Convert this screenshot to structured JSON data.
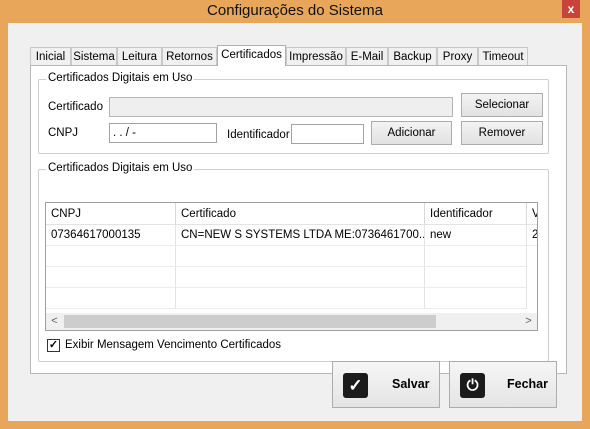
{
  "window": {
    "title": "Configurações do Sistema",
    "close_glyph": "x"
  },
  "tabs": [
    "Inicial",
    "Sistema",
    "Leitura",
    "Retornos",
    "Certificados",
    "Impressão",
    "E-Mail",
    "Backup",
    "Proxy",
    "Timeout"
  ],
  "active_tab": "Certificados",
  "top_group": {
    "title": "Certificados Digitais em Uso",
    "certificado_label": "Certificado",
    "certificado_value": "",
    "cnpj_label": "CNPJ",
    "cnpj_value": " .  .  /   -",
    "identificador_label": "Identificador",
    "identificador_value": "",
    "selecionar_button": "Selecionar",
    "adicionar_button": "Adicionar",
    "remover_button": "Remover"
  },
  "list_group": {
    "title": "Certificados Digitais em Uso",
    "columns": [
      "CNPJ",
      "Certificado",
      "Identificador",
      "V"
    ],
    "rows": [
      [
        "07364617000135",
        "CN=NEW S SYSTEMS LTDA ME:0736461700...",
        "new",
        "2"
      ]
    ],
    "scroll_left": "<",
    "scroll_right": ">"
  },
  "checkbox": {
    "checked": true,
    "mark": "✓",
    "label": "Exibir Mensagem Vencimento Certificados"
  },
  "footer": {
    "salvar_label": "Salvar",
    "salvar_icon": "✓",
    "fechar_label": "Fechar",
    "fechar_icon": "⏻"
  }
}
